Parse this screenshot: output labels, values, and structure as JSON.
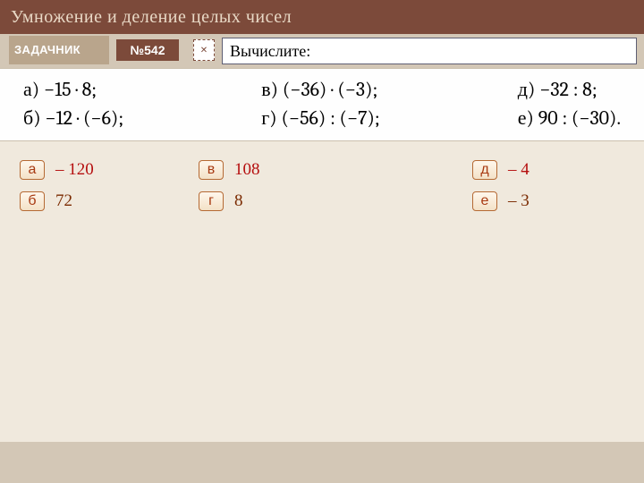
{
  "header": {
    "title": "Умножение и деление целых чисел"
  },
  "subbar": {
    "tab_label": "ЗАДАЧНИК",
    "problem_number": "№542",
    "instruction": "Вычислите:"
  },
  "problems": {
    "col1": [
      "а) −15 · 8;",
      "б) −12 · (−6);"
    ],
    "col2": [
      "в) (−36) · (−3);",
      "г) (−56) : (−7);"
    ],
    "col3": [
      "д) −32 : 8;",
      "е) 90 : (−30)."
    ]
  },
  "answers": [
    {
      "key": "а",
      "value": "– 120",
      "style": "val1"
    },
    {
      "key": "в",
      "value": "108",
      "style": "val1"
    },
    {
      "key": "д",
      "value": "– 4",
      "style": "val1"
    },
    {
      "key": "б",
      "value": "72",
      "style": "val2"
    },
    {
      "key": "г",
      "value": "8",
      "style": "val2"
    },
    {
      "key": "е",
      "value": "– 3",
      "style": "val2"
    }
  ]
}
